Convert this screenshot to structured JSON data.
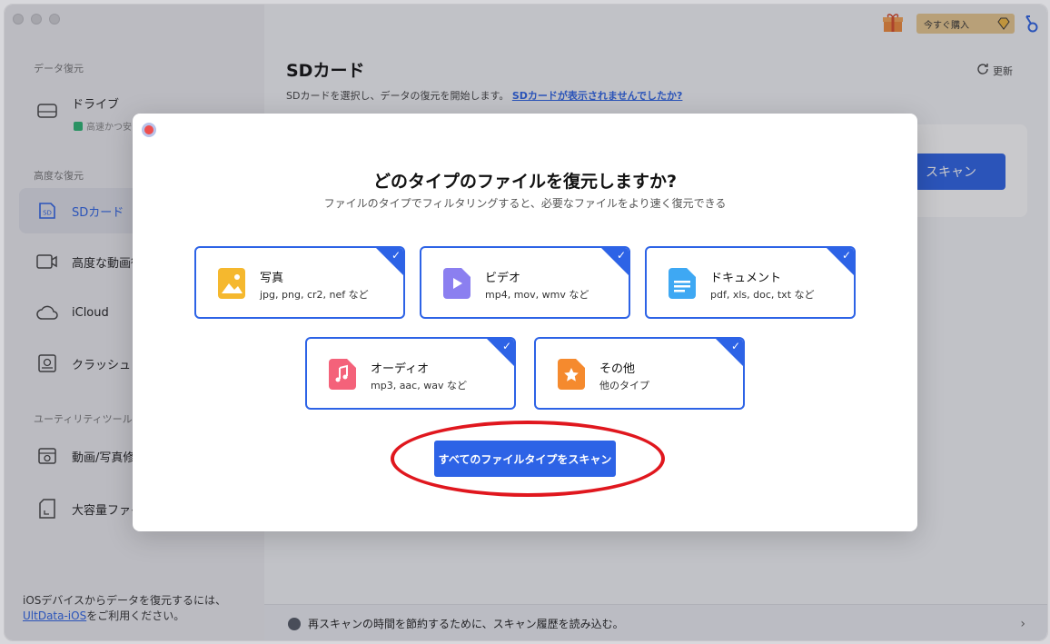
{
  "sidebar": {
    "section_data_recovery": "データ復元",
    "drive_label": "ドライブ",
    "drive_sub": "高速かつ安",
    "section_advanced": "高度な復元",
    "items": [
      {
        "label": "SDカード"
      },
      {
        "label": "高度な動画復"
      },
      {
        "label": "iCloud"
      },
      {
        "label": "クラッシュし"
      }
    ],
    "section_utility": "ユーティリティツール",
    "utility_items": [
      {
        "label": "動画/写真修"
      },
      {
        "label": "大容量ファイ"
      }
    ],
    "footer_text1": "iOSデバイスからデータを復元するには、",
    "footer_link": "UltData-iOS",
    "footer_text2": "をご利用ください。"
  },
  "header": {
    "buy_label": "今すぐ購入",
    "refresh_label": "更新"
  },
  "main": {
    "title": "SDカード",
    "subtitle": "SDカードを選択し、データの復元を開始します。",
    "help_link": "SDカードが表示されませんでしたか?",
    "scan_label": "スキャン",
    "bottom_text": "再スキャンの時間を節約するために、スキャン履歴を読み込む。"
  },
  "modal": {
    "title": "どのタイプのファイルを復元しますか?",
    "subtitle": "ファイルのタイプでフィルタリングすると、必要なファイルをより速く復元できる",
    "types": [
      {
        "name": "写真",
        "desc": "jpg, png, cr2, nef など",
        "color": "#f5b82e",
        "checked": true
      },
      {
        "name": "ビデオ",
        "desc": "mp4, mov, wmv など",
        "color": "#8b7ff0",
        "checked": true
      },
      {
        "name": "ドキュメント",
        "desc": "pdf, xls, doc, txt など",
        "color": "#3ea8f3",
        "checked": true
      },
      {
        "name": "オーディオ",
        "desc": "mp3, aac, wav など",
        "color": "#f4627a",
        "checked": true
      },
      {
        "name": "その他",
        "desc": "他のタイプ",
        "color": "#f58a2e",
        "checked": true
      }
    ],
    "scan_all_label": "すべてのファイルタイプをスキャン"
  },
  "colors": {
    "accent": "#2d63e6",
    "highlight_ring": "#e0171e"
  }
}
